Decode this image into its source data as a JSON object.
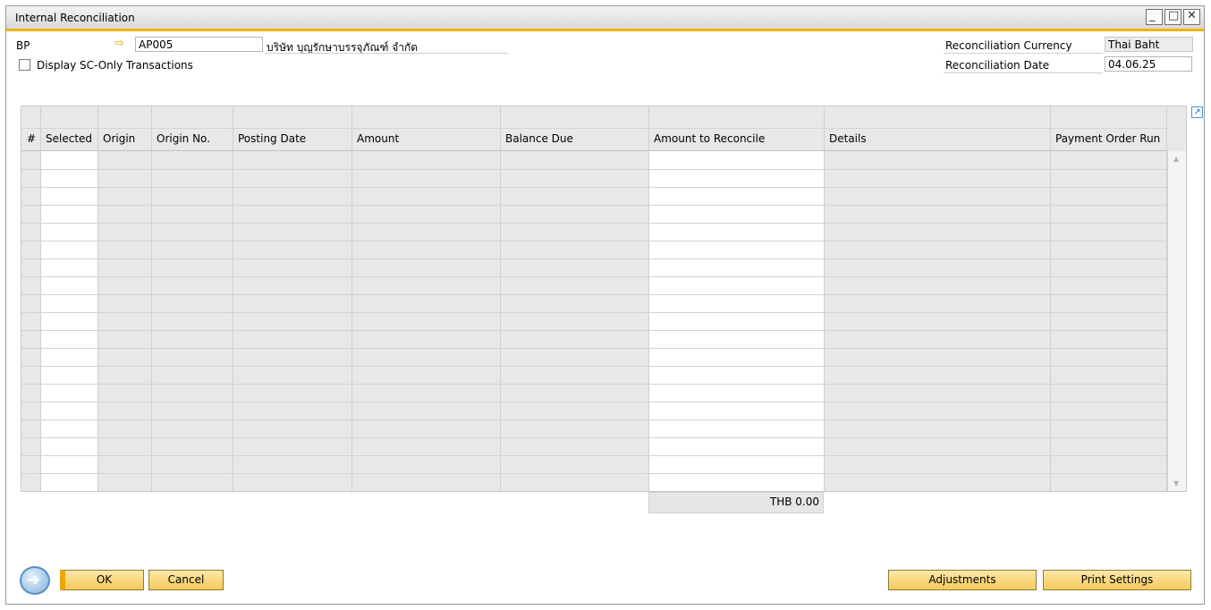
{
  "window": {
    "title": "Internal Reconciliation",
    "controls": {
      "minimize": "_",
      "maximize": "□",
      "close": "✕"
    }
  },
  "header": {
    "bp_label": "BP",
    "bp_code": "AP005",
    "bp_name": "บริษัท บุญรักษาบรรจุภัณฑ์ จำกัด",
    "sc_only_label": "Display SC-Only Transactions",
    "sc_only_checked": false,
    "currency_label": "Reconciliation Currency",
    "currency_value": "Thai Baht",
    "date_label": "Reconciliation Date",
    "date_value": "04.06.25"
  },
  "table": {
    "columns": [
      "#",
      "Selected",
      "Origin",
      "Origin No.",
      "Posting Date",
      "Amount",
      "Balance Due",
      "Amount to Reconcile",
      "Details",
      "Payment Order Run"
    ],
    "rows": []
  },
  "total": "THB 0.00",
  "buttons": {
    "ok": "OK",
    "cancel": "Cancel",
    "adjustments": "Adjustments",
    "print_settings": "Print Settings"
  },
  "icons": {
    "link_arrow": "link-arrow-icon",
    "expand": "expand-icon",
    "back": "back-arrow-icon"
  },
  "colors": {
    "accent": "#f0b400",
    "button": "#f6c95a",
    "grid_bg": "#e8e8e8"
  }
}
